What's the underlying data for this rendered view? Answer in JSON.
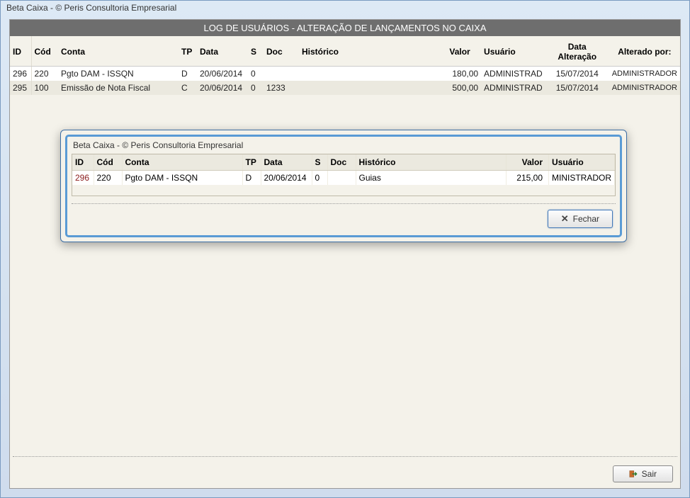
{
  "window": {
    "title": "Beta Caixa - © Peris Consultoria Empresarial"
  },
  "header": {
    "title": "LOG DE USUÁRIOS - ALTERAÇÃO DE LANÇAMENTOS NO CAIXA"
  },
  "columns": {
    "id": "ID",
    "cod": "Cód",
    "conta": "Conta",
    "tp": "TP",
    "data": "Data",
    "s": "S",
    "doc": "Doc",
    "historico": "Histórico",
    "valor": "Valor",
    "usuario": "Usuário",
    "data_alteracao": "Data Alteração",
    "alterado_por": "Alterado por:"
  },
  "rows": [
    {
      "id": "296",
      "cod": "220",
      "conta": "Pgto DAM - ISSQN",
      "tp": "D",
      "data": "20/06/2014",
      "s": "0",
      "doc": "",
      "historico": "",
      "valor": "180,00",
      "usuario": "ADMINISTRAD",
      "data_alteracao": "15/07/2014",
      "alterado_por": "ADMINISTRADOR"
    },
    {
      "id": "295",
      "cod": "100",
      "conta": "Emissão de Nota Fiscal",
      "tp": "C",
      "data": "20/06/2014",
      "s": "0",
      "doc": "1233",
      "historico": "",
      "valor": "500,00",
      "usuario": "ADMINISTRAD",
      "data_alteracao": "15/07/2014",
      "alterado_por": "ADMINISTRADOR"
    }
  ],
  "modal": {
    "title": "Beta Caixa - © Peris Consultoria Empresarial",
    "columns": {
      "id": "ID",
      "cod": "Cód",
      "conta": "Conta",
      "tp": "TP",
      "data": "Data",
      "s": "S",
      "doc": "Doc",
      "historico": "Histórico",
      "valor": "Valor",
      "usuario": "Usuário"
    },
    "row": {
      "id": "296",
      "cod": "220",
      "conta": "Pgto DAM - ISSQN",
      "tp": "D",
      "data": "20/06/2014",
      "s": "0",
      "doc": "",
      "historico": "Guias",
      "valor": "215,00",
      "usuario": "MINISTRADOR"
    },
    "close_label": "Fechar"
  },
  "footer": {
    "sair_label": "Sair"
  }
}
